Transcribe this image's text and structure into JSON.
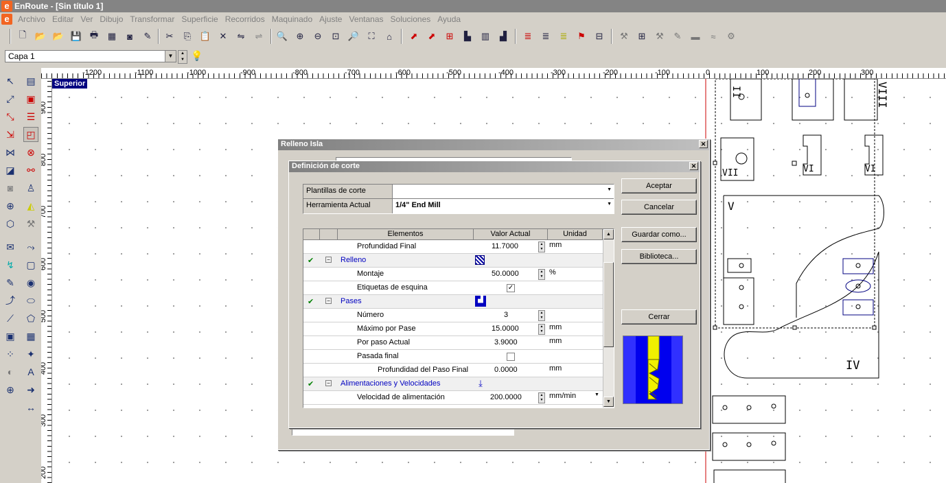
{
  "app": {
    "title": "EnRoute - [Sin título 1]",
    "logo_letter": "e"
  },
  "menu": [
    "Archivo",
    "Editar",
    "Ver",
    "Dibujo",
    "Transformar",
    "Superficie",
    "Recorridos",
    "Maquinado",
    "Ajuste",
    "Ventanas",
    "Soluciones",
    "Ayuda"
  ],
  "layer": {
    "selected": "Capa 1"
  },
  "view": {
    "label": "Superior"
  },
  "ruler": {
    "h_labels": [
      "-1200",
      "-1100",
      "-1000",
      "-900",
      "-800",
      "-700",
      "-600",
      "-500",
      "-400",
      "-300",
      "-200",
      "-100",
      "0",
      "100",
      "200",
      "300"
    ],
    "v_labels": [
      "900",
      "800",
      "700",
      "600",
      "500",
      "400",
      "300",
      "200"
    ]
  },
  "outer_dialog": {
    "title": "Relleno Isla"
  },
  "dialog": {
    "title": "Definición de corte",
    "templates_label": "Plantillas de corte",
    "templates_value": "",
    "tool_label": "Herramienta Actual",
    "tool_value": "1/4\" End Mill",
    "buttons": {
      "accept": "Aceptar",
      "cancel": "Cancelar",
      "save_as": "Guardar como...",
      "library": "Biblioteca...",
      "close": "Cerrar"
    },
    "table": {
      "headers": {
        "elements": "Elementos",
        "value": "Valor Actual",
        "unit": "Unidad"
      },
      "rows": [
        {
          "label": "Profundidad Final",
          "value": "11.7000",
          "unit": "mm"
        },
        {
          "label": "Relleno",
          "group": true
        },
        {
          "label": "Montaje",
          "value": "50.0000",
          "unit": "%"
        },
        {
          "label": "Etiquetas de esquina",
          "checkbox": true,
          "checked": true
        },
        {
          "label": "Pases",
          "group": true
        },
        {
          "label": "Número",
          "value": "3",
          "unit": ""
        },
        {
          "label": "Máximo por Pase",
          "value": "15.0000",
          "unit": "mm"
        },
        {
          "label": "Por paso Actual",
          "value": "3.9000",
          "unit": "mm"
        },
        {
          "label": "Pasada final",
          "checkbox": true,
          "checked": false
        },
        {
          "label": "Profundidad del Paso Final",
          "value": "0.0000",
          "unit": "mm"
        },
        {
          "label": "Alimentaciones y Velocidades",
          "group": true
        },
        {
          "label": "Velocidad de alimentación",
          "value": "200.0000",
          "unit": "mm/min"
        }
      ]
    }
  },
  "parts": {
    "labels": [
      "VIII",
      "VII",
      "VI",
      "VI",
      "V",
      "IV",
      "II"
    ]
  },
  "colors": {
    "title_bar": "#848484",
    "selection": "#000080",
    "origin_line": "#cc0000",
    "tool_preview_bg": "#0000ee"
  }
}
